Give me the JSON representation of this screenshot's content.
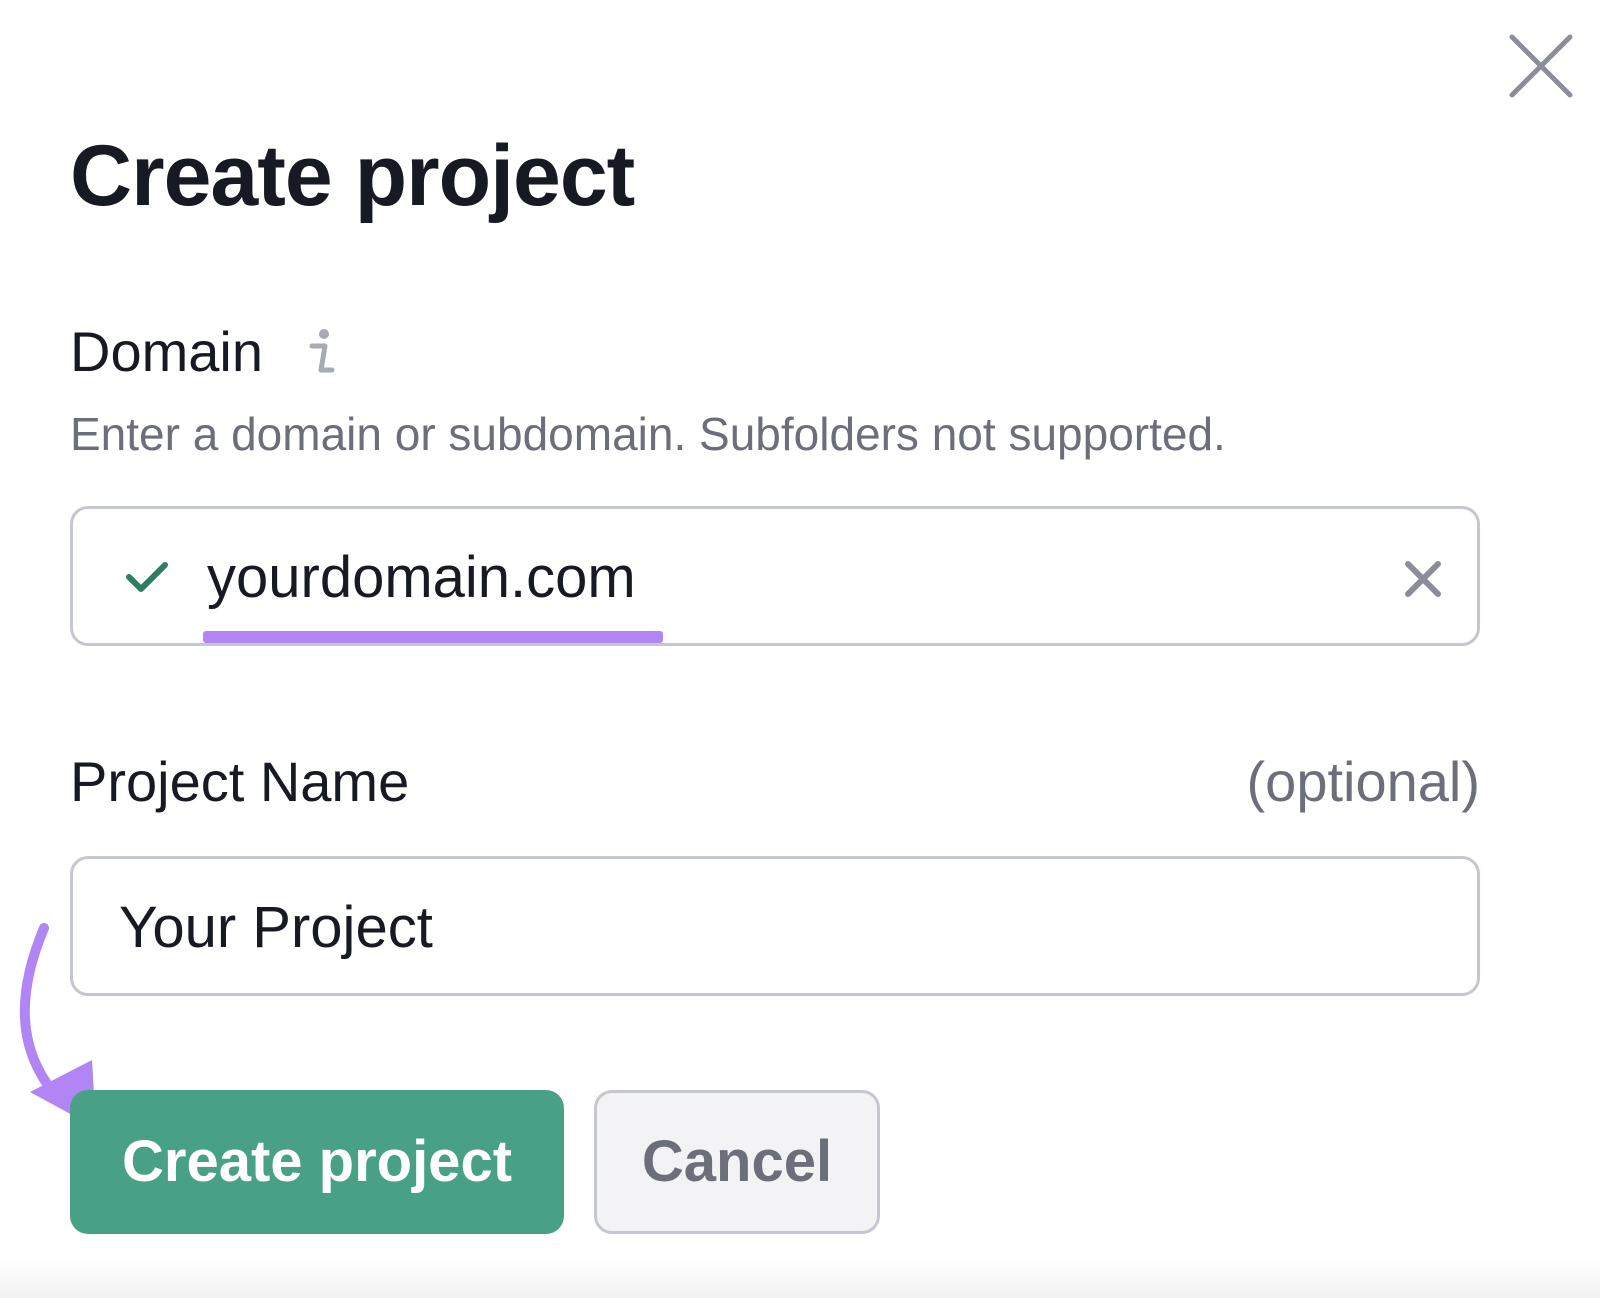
{
  "dialog": {
    "title": "Create project",
    "close_icon": "close-icon"
  },
  "domain": {
    "label": "Domain",
    "info_icon": "info-icon",
    "hint": "Enter a domain or subdomain. Subfolders not supported.",
    "value": "yourdomain.com",
    "status_icon": "check-icon",
    "clear_icon": "clear-icon"
  },
  "project_name": {
    "label": "Project Name",
    "optional_label": "(optional)",
    "value": "Your Project"
  },
  "buttons": {
    "create_label": "Create project",
    "cancel_label": "Cancel"
  },
  "colors": {
    "primary": "#48a184",
    "annotation": "#b285f5",
    "check": "#2e7f62",
    "border": "#c4c7cf",
    "muted_text": "#6c6e79"
  }
}
